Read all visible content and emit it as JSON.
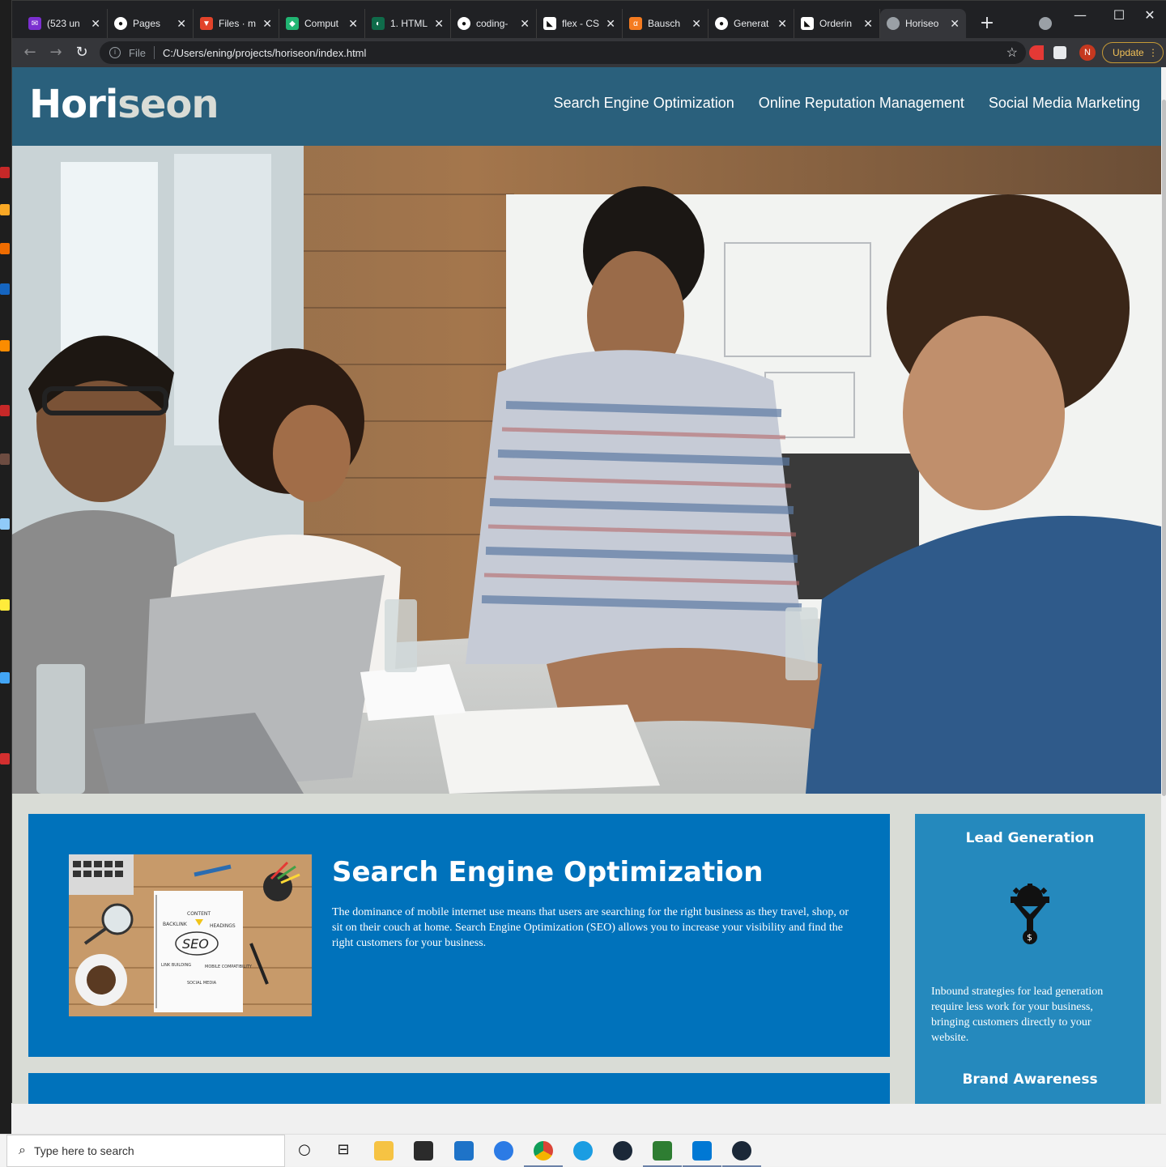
{
  "browser": {
    "tabs": [
      {
        "label": "(523 un",
        "icon": "mail-icon",
        "color": "#7b2fd0"
      },
      {
        "label": "Pages",
        "icon": "github-icon",
        "color": "#ffffff"
      },
      {
        "label": "Files · m",
        "icon": "gitlab-icon",
        "color": "#e2432a"
      },
      {
        "label": "Comput",
        "icon": "app-icon",
        "color": "#21b573"
      },
      {
        "label": "1. HTML",
        "icon": "app-icon",
        "color": "#0f6b4a"
      },
      {
        "label": "coding-",
        "icon": "github-icon",
        "color": "#ffffff"
      },
      {
        "label": "flex - CS",
        "icon": "cat-icon",
        "color": "#ffffff"
      },
      {
        "label": "Bausch",
        "icon": "app-icon",
        "color": "#f47b20"
      },
      {
        "label": "Generat",
        "icon": "github-icon",
        "color": "#ffffff"
      },
      {
        "label": "Orderin",
        "icon": "cat-icon",
        "color": "#ffffff"
      },
      {
        "label": "Horiseo",
        "icon": "globe-icon",
        "color": "#9aa0a6"
      }
    ],
    "address": {
      "scheme": "File",
      "url": "C:/Users/ening/projects/horiseon/index.html"
    },
    "profile_initial": "N",
    "update_label": "Update"
  },
  "site": {
    "logo_main": "Hori",
    "logo_accent": "seon",
    "nav": [
      "Search Engine Optimization",
      "Online Reputation Management",
      "Social Media Marketing"
    ],
    "seo": {
      "title": "Search Engine Optimization",
      "text": "The dominance of mobile internet use means that users are searching for the right business as they travel, shop, or sit on their couch at home. Search Engine Optimization (SEO) allows you to increase your visibility and find the right customers for your business.",
      "image_words": [
        "CONTENT",
        "BACKLINK",
        "HEADINGS",
        "SEO",
        "LINK BUILDING",
        "MOBILE COMPATIBILITY",
        "SOCIAL MEDIA"
      ]
    },
    "aside": {
      "lead_title": "Lead Generation",
      "lead_text": "Inbound strategies for lead generation require less work for your business, bringing customers directly to your website.",
      "brand_title": "Brand Awareness"
    },
    "colors": {
      "header": "#2a607c",
      "card": "#0072bb",
      "aside": "#2589bd",
      "background": "#d9dcd6"
    }
  },
  "taskbar": {
    "search_placeholder": "Type here to search"
  }
}
